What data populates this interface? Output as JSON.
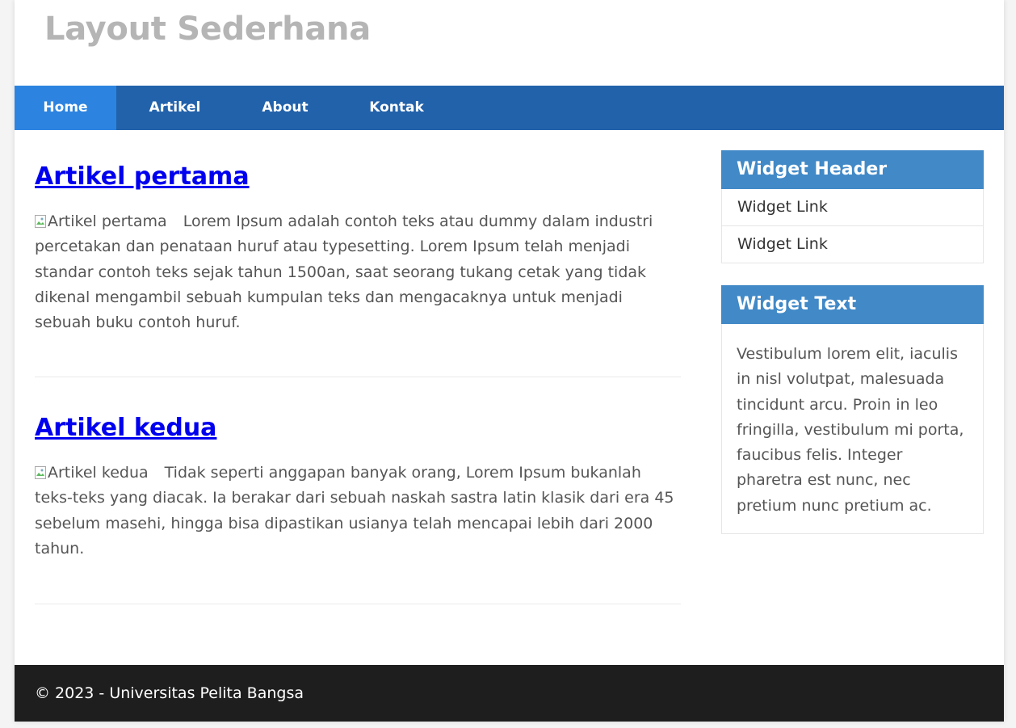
{
  "header": {
    "title": "Layout Sederhana"
  },
  "nav": {
    "items": [
      {
        "label": "Home"
      },
      {
        "label": "Artikel"
      },
      {
        "label": "About"
      },
      {
        "label": "Kontak"
      }
    ]
  },
  "articles": [
    {
      "title": "Artikel pertama",
      "image_alt": "Artikel pertama",
      "body": "Lorem Ipsum adalah contoh teks atau dummy dalam industri percetakan dan penataan huruf atau typesetting. Lorem Ipsum telah menjadi standar contoh teks sejak tahun 1500an, saat seorang tukang cetak yang tidak dikenal mengambil sebuah kumpulan teks dan mengacaknya untuk menjadi sebuah buku contoh huruf."
    },
    {
      "title": "Artikel kedua",
      "image_alt": "Artikel kedua",
      "body": "Tidak seperti anggapan banyak orang, Lorem Ipsum bukanlah teks-teks yang diacak. Ia berakar dari sebuah naskah sastra latin klasik dari era 45 sebelum masehi, hingga bisa dipastikan usianya telah mencapai lebih dari 2000 tahun."
    }
  ],
  "sidebar": {
    "widget_links": {
      "header": "Widget Header",
      "links": [
        {
          "label": "Widget Link"
        },
        {
          "label": "Widget Link"
        }
      ]
    },
    "widget_text": {
      "header": "Widget Text",
      "body": "Vestibulum lorem elit, iaculis in nisl volutpat, malesuada tincidunt arcu. Proin in leo fringilla, vestibulum mi porta, faucibus felis. Integer pharetra est nunc, nec pretium nunc pretium ac."
    }
  },
  "footer": {
    "text": "© 2023 - Universitas Pelita Bangsa"
  },
  "colors": {
    "nav_background": "#2262ab",
    "nav_active": "#2d84e0",
    "widget_header": "#4189c7",
    "footer_background": "#1e1e1e",
    "title_gray": "#b5b5b5",
    "link_blue": "#0000ee"
  }
}
